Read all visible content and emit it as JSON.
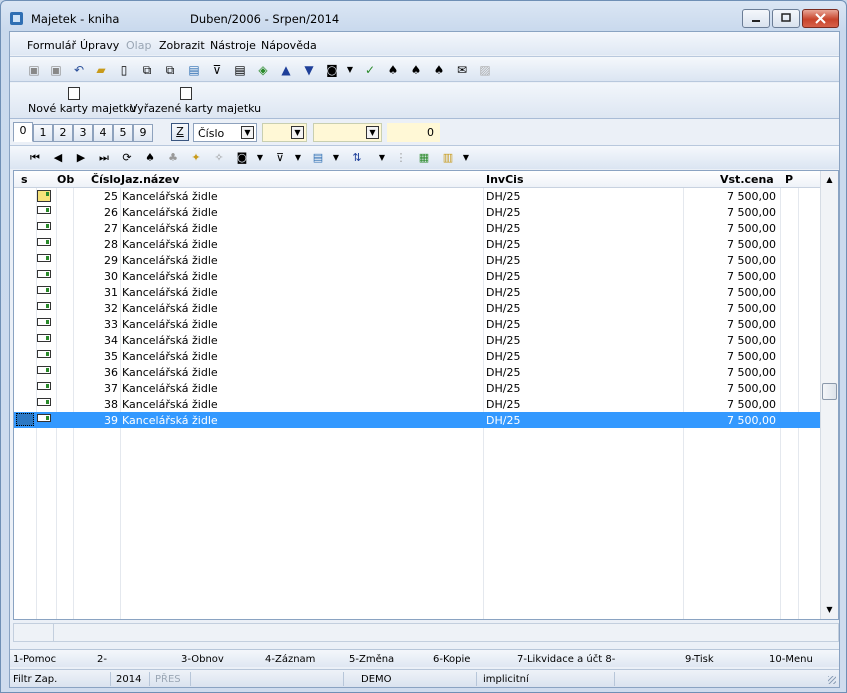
{
  "window": {
    "title": "Majetek - kniha",
    "subtitle": "Duben/2006 - Srpen/2014"
  },
  "menu": [
    {
      "label": "Formulář",
      "disabled": false
    },
    {
      "label": "Úpravy",
      "disabled": false
    },
    {
      "label": "Olap",
      "disabled": true
    },
    {
      "label": "Zobrazit",
      "disabled": false
    },
    {
      "label": "Nástroje",
      "disabled": false
    },
    {
      "label": "Nápověda",
      "disabled": false
    }
  ],
  "actions": {
    "new_cards": "Nové karty majetku",
    "retired_cards": "Vyřazené karty majetku"
  },
  "tabs": [
    "0",
    "1",
    "2",
    "3",
    "4",
    "5",
    "9"
  ],
  "filter": {
    "z_label": "Z",
    "sort_field": "Číslo",
    "number_value": "0"
  },
  "grid": {
    "headers": {
      "s": "s",
      "ob": "Ob",
      "cislo": "Číslo",
      "nazev": "Jaz.název",
      "invcis": "InvCis",
      "cena": "Vst.cena",
      "p": "P"
    },
    "rows": [
      {
        "cislo": "25",
        "nazev": "Kancelářská židle",
        "invcis": "DH/25",
        "cena": "7 500,00"
      },
      {
        "cislo": "26",
        "nazev": "Kancelářská židle",
        "invcis": "DH/25",
        "cena": "7 500,00"
      },
      {
        "cislo": "27",
        "nazev": "Kancelářská židle",
        "invcis": "DH/25",
        "cena": "7 500,00"
      },
      {
        "cislo": "28",
        "nazev": "Kancelářská židle",
        "invcis": "DH/25",
        "cena": "7 500,00"
      },
      {
        "cislo": "29",
        "nazev": "Kancelářská židle",
        "invcis": "DH/25",
        "cena": "7 500,00"
      },
      {
        "cislo": "30",
        "nazev": "Kancelářská židle",
        "invcis": "DH/25",
        "cena": "7 500,00"
      },
      {
        "cislo": "31",
        "nazev": "Kancelářská židle",
        "invcis": "DH/25",
        "cena": "7 500,00"
      },
      {
        "cislo": "32",
        "nazev": "Kancelářská židle",
        "invcis": "DH/25",
        "cena": "7 500,00"
      },
      {
        "cislo": "33",
        "nazev": "Kancelářská židle",
        "invcis": "DH/25",
        "cena": "7 500,00"
      },
      {
        "cislo": "34",
        "nazev": "Kancelářská židle",
        "invcis": "DH/25",
        "cena": "7 500,00"
      },
      {
        "cislo": "35",
        "nazev": "Kancelářská židle",
        "invcis": "DH/25",
        "cena": "7 500,00"
      },
      {
        "cislo": "36",
        "nazev": "Kancelářská židle",
        "invcis": "DH/25",
        "cena": "7 500,00"
      },
      {
        "cislo": "37",
        "nazev": "Kancelářská židle",
        "invcis": "DH/25",
        "cena": "7 500,00"
      },
      {
        "cislo": "38",
        "nazev": "Kancelářská židle",
        "invcis": "DH/25",
        "cena": "7 500,00"
      },
      {
        "cislo": "39",
        "nazev": "Kancelářská židle",
        "invcis": "DH/25",
        "cena": "7 500,00"
      }
    ]
  },
  "fkeys": [
    "1-Pomoc",
    "2-",
    "3-Obnov",
    "4-Záznam",
    "5-Změna",
    "6-Kopie",
    "7-Likvidace a účt 8-",
    "9-Tisk",
    "10-Menu"
  ],
  "status": {
    "filter": "Filtr Zap.",
    "year": "2014",
    "mode": "PŘES",
    "db": "DEMO",
    "profile": "implicitní"
  },
  "colors": {
    "selection": "#3399ff",
    "field_bg": "#fff8d6"
  }
}
